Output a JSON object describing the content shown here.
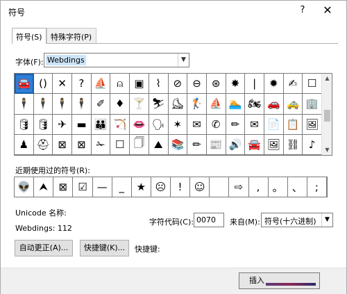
{
  "window": {
    "title": "符号",
    "help": "?",
    "close": "✕"
  },
  "tabs": [
    {
      "label": "符号(S)"
    },
    {
      "label": "特殊字符(P)"
    }
  ],
  "font": {
    "label": "字体(F):",
    "value": "Webdings"
  },
  "symbols": [
    "🚘",
    "()",
    "✕",
    "?",
    "⛵",
    "⍝",
    "▣",
    "⌇",
    "⊘",
    "⊖",
    "⊛",
    "✸",
    "|",
    "✹",
    "✍",
    "☐",
    "🕴",
    "🕴",
    "🕴",
    "🕴",
    "✐",
    "♦",
    "🍸",
    "⛷",
    "⛸",
    "🏌",
    "⛵",
    "🏊",
    "🏍",
    "🚗",
    "🚕",
    "🏢",
    "🛢",
    "🛢",
    "✈",
    "▬",
    "👪",
    "🏹",
    "👄",
    "🗣",
    "✶",
    "✉",
    "✆",
    "✏",
    "✉",
    "📄",
    "📋",
    "🖼",
    "♟",
    "⛑",
    "⊠",
    "⊠",
    "✁",
    "☐",
    "🗍",
    "⛰",
    "📚",
    "✏",
    "📰",
    "🔊",
    "🚘",
    "🖼",
    "⛓",
    "♪"
  ],
  "selected_index": 0,
  "recent": {
    "label": "近期使用过的符号(R):",
    "items": [
      "👽",
      "⮝",
      "⊠",
      "☑",
      "—",
      "_",
      "★",
      "☹",
      "!",
      "☺",
      "",
      "⇨",
      ",",
      "。",
      "、",
      ";"
    ]
  },
  "unicode": {
    "name_label": "Unicode 名称:",
    "value": "Webdings: 112"
  },
  "char_code": {
    "label": "字符代码(C):",
    "value": "0070"
  },
  "from": {
    "label": "来自(M):",
    "value": "符号(十六进制)"
  },
  "buttons": {
    "autocorrect": "自动更正(A)...",
    "shortcut_key": "快捷键(K)...",
    "shortcut_label": "快捷键:",
    "insert": "插入"
  }
}
